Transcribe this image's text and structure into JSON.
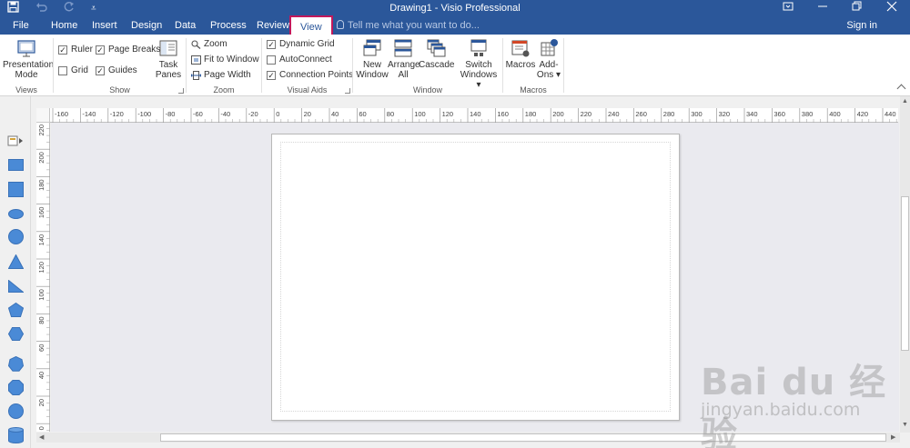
{
  "title_bar": {
    "title": "Drawing1 - Visio Professional",
    "qat": {
      "save_icon": "save-icon",
      "undo_icon": "undo-icon",
      "redo_icon": "redo-icon",
      "customize": "⩡"
    },
    "window_controls": [
      "ribbon-display-icon",
      "minimize-icon",
      "restore-icon",
      "close-icon"
    ]
  },
  "tabs": [
    "File",
    "Home",
    "Insert",
    "Design",
    "Data",
    "Process",
    "Review",
    "View"
  ],
  "active_tab": "View",
  "tell_me": "Tell me what you want to do...",
  "sign_in": "Sign in",
  "ribbon": {
    "views": {
      "label": "Views",
      "presentation": [
        "Presentation",
        "Mode"
      ]
    },
    "show": {
      "label": "Show",
      "ruler": "Ruler",
      "ruler_checked": true,
      "page_breaks": "Page Breaks",
      "page_breaks_checked": true,
      "grid": "Grid",
      "grid_checked": false,
      "guides": "Guides",
      "guides_checked": true,
      "task_panes": [
        "Task",
        "Panes"
      ]
    },
    "zoom": {
      "label": "Zoom",
      "zoom": "Zoom",
      "fit": "Fit to Window",
      "page_width": "Page Width"
    },
    "visual_aids": {
      "label": "Visual Aids",
      "dynamic_grid": "Dynamic Grid",
      "dynamic_grid_checked": true,
      "autoconnect": "AutoConnect",
      "autoconnect_checked": false,
      "connection_points": "Connection Points",
      "connection_points_checked": true
    },
    "window": {
      "label": "Window",
      "new_window": [
        "New",
        "Window"
      ],
      "arrange_all": [
        "Arrange",
        "All"
      ],
      "cascade": "Cascade",
      "switch_windows": [
        "Switch",
        "Windows ▾"
      ]
    },
    "macros": {
      "label": "Macros",
      "macros": "Macros",
      "addons": [
        "Add-",
        "Ons ▾"
      ]
    }
  },
  "ruler": {
    "h_ticks": [
      "-160",
      "-140",
      "-120",
      "-100",
      "-80",
      "-60",
      "-40",
      "-20",
      "0",
      "20",
      "40",
      "60",
      "80",
      "100",
      "120",
      "140",
      "160",
      "180",
      "200",
      "220",
      "240",
      "260",
      "280",
      "300",
      "320",
      "340",
      "360",
      "380",
      "400",
      "420",
      "440"
    ],
    "v_ticks": [
      "220",
      "200",
      "180",
      "160",
      "140",
      "120",
      "100",
      "80",
      "60",
      "40",
      "20",
      "0"
    ]
  },
  "stencil_shapes": [
    "stencil-menu-icon",
    "rectangle-shape",
    "square-shape",
    "ellipse-shape",
    "circle-shape",
    "triangle-shape",
    "right-triangle-shape",
    "pentagon-shape",
    "hexagon-shape",
    "heptagon-shape",
    "octagon-shape",
    "decagon-shape",
    "can-shape"
  ],
  "accent_color": "#2b579a",
  "highlight_color": "#c2185b",
  "shape_color": "#4a8ad6",
  "watermark": {
    "brand": "Bai du 经验",
    "url": "jingyan.baidu.com"
  }
}
